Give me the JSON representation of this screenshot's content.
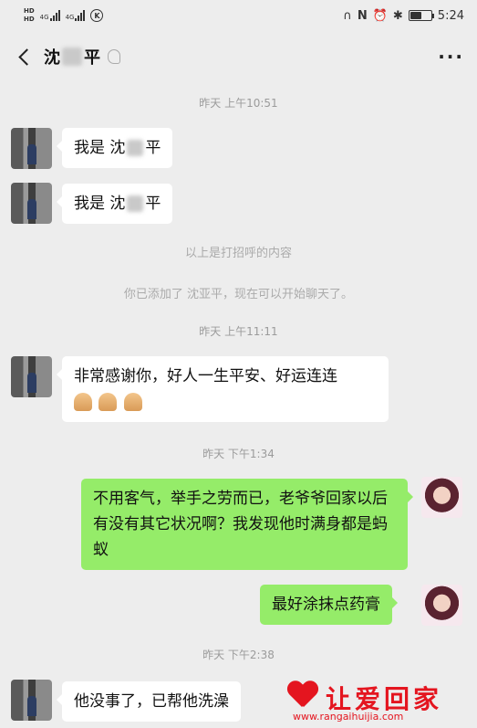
{
  "status_bar": {
    "hd1": "HD",
    "hd2": "HD",
    "net1": "4G",
    "net2": "4G",
    "time": "5:24",
    "icons": [
      "headset-icon",
      "nfc-icon",
      "alarm-icon",
      "bluetooth-icon",
      "battery-icon"
    ]
  },
  "header": {
    "name_prefix": "沈",
    "name_suffix": "平",
    "more": "···"
  },
  "messages": [
    {
      "type": "timestamp",
      "text": "昨天 上午10:51"
    },
    {
      "type": "incoming",
      "text_a": "我是 沈",
      "text_b": "平"
    },
    {
      "type": "incoming",
      "text_a": "我是 沈",
      "text_b": "平"
    },
    {
      "type": "system",
      "text": "以上是打招呼的内容"
    },
    {
      "type": "system",
      "text": "你已添加了 沈亚平，现在可以开始聊天了。"
    },
    {
      "type": "timestamp",
      "text": "昨天 上午11:11"
    },
    {
      "type": "incoming",
      "text": "非常感谢你，好人一生平安、好运连连"
    },
    {
      "type": "timestamp",
      "text": "昨天 下午1:34"
    },
    {
      "type": "outgoing",
      "text": "不用客气，举手之劳而已，老爷爷回家以后有没有其它状况啊？我发现他时满身都是蚂蚁"
    },
    {
      "type": "outgoing",
      "text": "最好涂抹点药膏"
    },
    {
      "type": "timestamp",
      "text": "昨天 下午2:38"
    },
    {
      "type": "incoming",
      "text": "他没事了，已帮他洗澡"
    }
  ],
  "watermark": {
    "text": "让爱回家",
    "url": "www.rangaihuijia.com"
  }
}
